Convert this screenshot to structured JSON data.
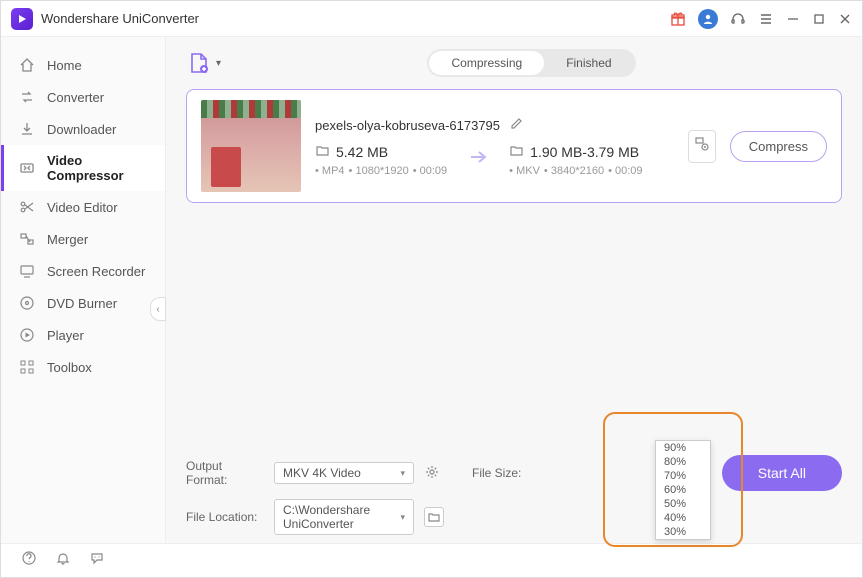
{
  "app": {
    "title": "Wondershare UniConverter"
  },
  "sidebar": {
    "items": [
      {
        "label": "Home"
      },
      {
        "label": "Converter"
      },
      {
        "label": "Downloader"
      },
      {
        "label": "Video Compressor"
      },
      {
        "label": "Video Editor"
      },
      {
        "label": "Merger"
      },
      {
        "label": "Screen Recorder"
      },
      {
        "label": "DVD Burner"
      },
      {
        "label": "Player"
      },
      {
        "label": "Toolbox"
      }
    ]
  },
  "tabs": {
    "compressing": "Compressing",
    "finished": "Finished"
  },
  "file": {
    "name": "pexels-olya-kobruseva-6173795",
    "src": {
      "size": "5.42 MB",
      "format": "MP4",
      "res": "1080*1920",
      "dur": "00:09"
    },
    "dst": {
      "size": "1.90 MB-3.79 MB",
      "format": "MKV",
      "res": "3840*2160",
      "dur": "00:09"
    },
    "compress_label": "Compress"
  },
  "bottom": {
    "output_format_label": "Output Format:",
    "output_format_value": "MKV 4K Video",
    "file_size_label": "File Size:",
    "file_location_label": "File Location:",
    "file_location_value": "C:\\Wondershare UniConverter",
    "start_all": "Start All"
  },
  "dropdown": {
    "options": [
      "90%",
      "80%",
      "70%",
      "60%",
      "50%",
      "40%",
      "30%"
    ]
  }
}
